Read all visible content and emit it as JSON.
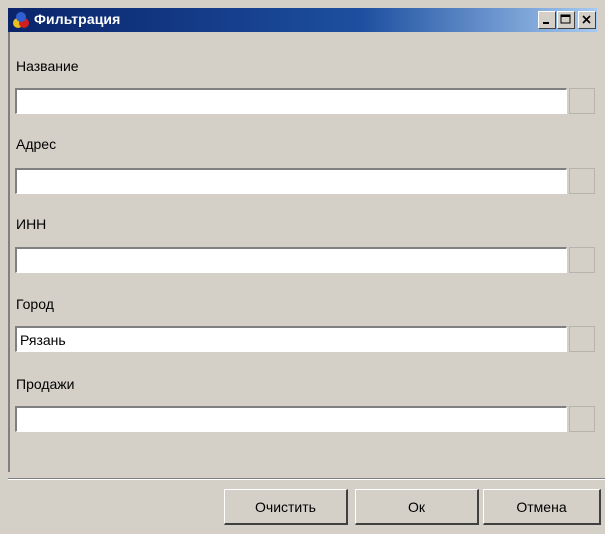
{
  "window": {
    "title": "Фильтрация",
    "icon": "filter-app-icon"
  },
  "fields": [
    {
      "label": "Название",
      "value": ""
    },
    {
      "label": "Адрес",
      "value": ""
    },
    {
      "label": "ИНН",
      "value": ""
    },
    {
      "label": "Город",
      "value": "Рязань"
    },
    {
      "label": "Продажи",
      "value": ""
    }
  ],
  "buttons": {
    "clear": "Очистить",
    "ok": "Ок",
    "cancel": "Отмена"
  },
  "colors": {
    "titlebar_start": "#0a246a",
    "titlebar_end": "#a6caf0",
    "face": "#d4d0c8"
  }
}
